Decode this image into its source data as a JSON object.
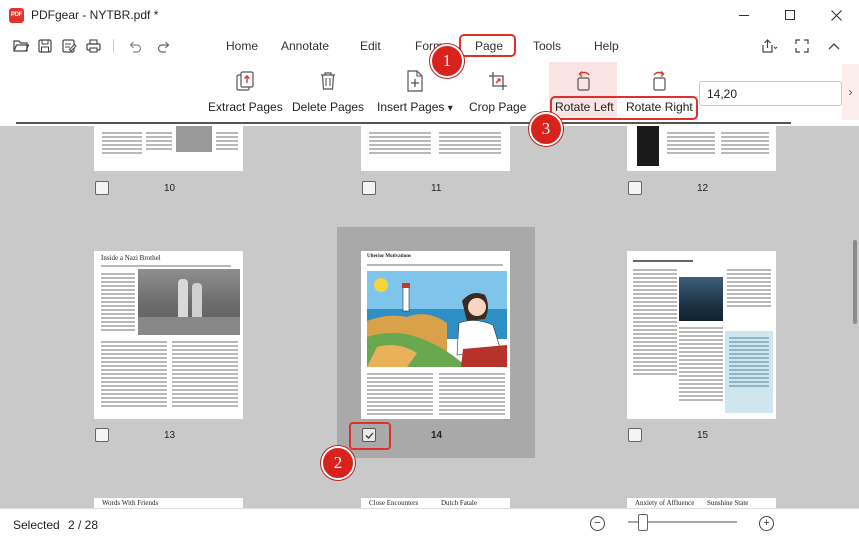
{
  "window": {
    "title": "PDFgear - NYTBR.pdf *",
    "logo_text": "PDF"
  },
  "menu": {
    "items": [
      "Home",
      "Annotate",
      "Edit",
      "Form",
      "Page",
      "Tools",
      "Help"
    ],
    "active": "Page"
  },
  "ribbon": {
    "tools": [
      {
        "label": "Extract Pages",
        "icon": "extract-pages-icon"
      },
      {
        "label": "Delete Pages",
        "icon": "trash-icon"
      },
      {
        "label": "Insert Pages",
        "icon": "insert-page-icon"
      },
      {
        "label": "Crop Page",
        "icon": "crop-icon"
      }
    ],
    "insert_arrow": "▾",
    "rotate_left": "Rotate Left",
    "rotate_right": "Rotate Right",
    "page_range_value": "14,20"
  },
  "thumbnails": {
    "top_row": [
      "10",
      "11",
      "12"
    ],
    "middle_row": [
      "13",
      "14",
      "15"
    ],
    "selected_page": "14",
    "bottom_titles": [
      "Words With Friends",
      "Close Encounters",
      "Dutch Fatale",
      "Anxiety of Affluence",
      "Sunshine State"
    ],
    "page13_title": "Inside a Nazi Brothel",
    "page14_title": "Ulterior Motivations"
  },
  "status": {
    "label": "Selected",
    "value": "2 / 28",
    "zoom_level": 0.1
  },
  "callouts": [
    "1",
    "2",
    "3"
  ],
  "colors": {
    "accent": "#e0302a",
    "callout": "#d9221c",
    "canvas": "#c9c9c9"
  }
}
